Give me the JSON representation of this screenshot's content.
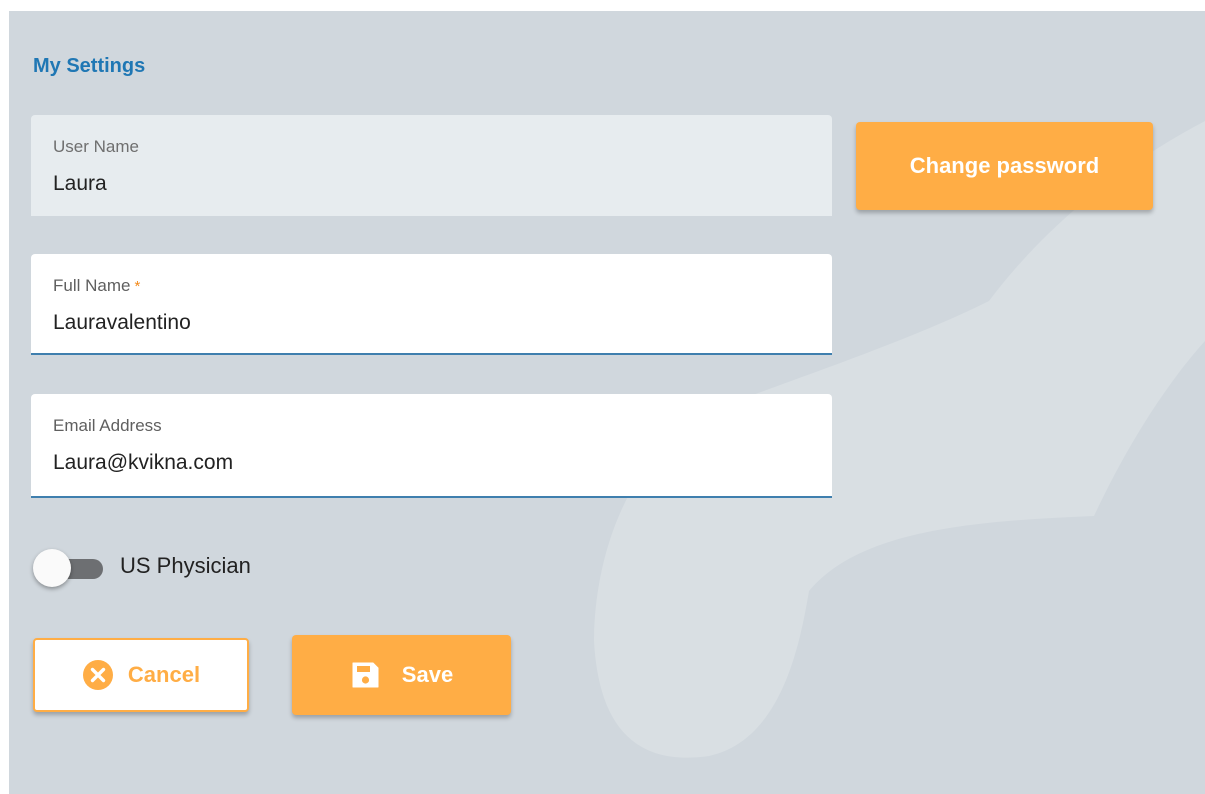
{
  "page": {
    "title": "My Settings"
  },
  "form": {
    "user_name": {
      "label": "User Name",
      "value": "Laura"
    },
    "full_name": {
      "label": "Full Name",
      "required_marker": "*",
      "value": "Lauravalentino"
    },
    "email": {
      "label": "Email Address",
      "value": "Laura@kvikna.com"
    },
    "us_physician": {
      "label": "US Physician",
      "checked": false
    }
  },
  "buttons": {
    "change_password": "Change password",
    "cancel": {
      "label": "Cancel",
      "icon": "cancel-circle-icon"
    },
    "save": {
      "label": "Save",
      "icon": "floppy-disk-icon"
    }
  },
  "colors": {
    "accent": "#ffad45",
    "title": "#1f77b4",
    "background": "#d0d7dd",
    "input_underline": "#3f7fae",
    "required": "#f28a1c"
  }
}
